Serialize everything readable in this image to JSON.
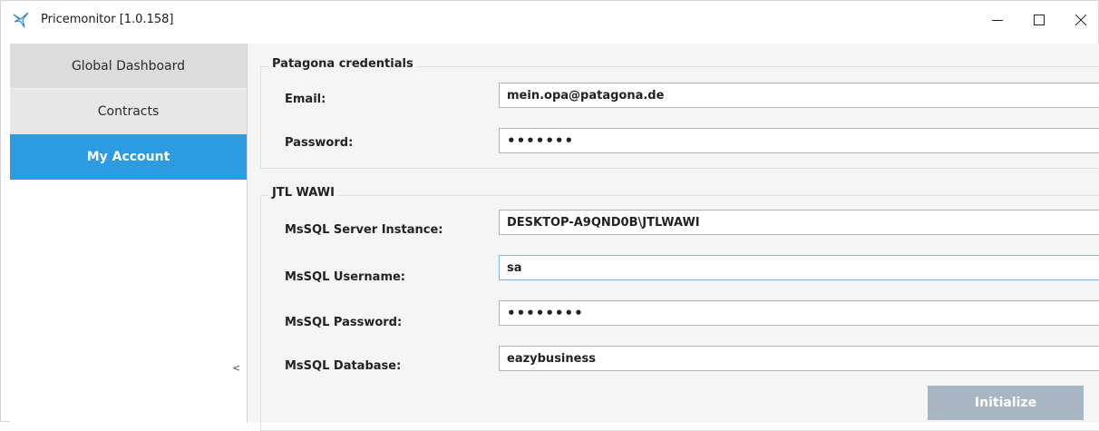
{
  "window": {
    "title": "Pricemonitor [1.0.158]",
    "icons": {
      "app": "bird-logo-icon",
      "minimize": "minimize-icon",
      "maximize": "maximize-icon",
      "close": "close-icon"
    }
  },
  "sidebar": {
    "items": [
      {
        "label": "Global Dashboard",
        "active": false
      },
      {
        "label": "Contracts",
        "active": false
      },
      {
        "label": "My Account",
        "active": true
      }
    ],
    "collapse_glyph": "<",
    "active_color": "#2d9be2"
  },
  "patagona": {
    "legend": "Patagona credentials",
    "email_label": "Email:",
    "email_value": "mein.opa@patagona.de",
    "password_label": "Password:",
    "password_value": "•••••••"
  },
  "jtl": {
    "legend": "JTL WAWI",
    "server_label": "MsSQL Server Instance:",
    "server_value": "DESKTOP-A9QND0B\\JTLWAWI",
    "username_label": "MsSQL Username:",
    "username_value": "sa",
    "password_label": "MsSQL Password:",
    "password_value": "••••••••",
    "database_label": "MsSQL Database:",
    "database_value": "eazybusiness"
  },
  "actions": {
    "initialize_label": "Initialize",
    "initialize_enabled": false
  }
}
